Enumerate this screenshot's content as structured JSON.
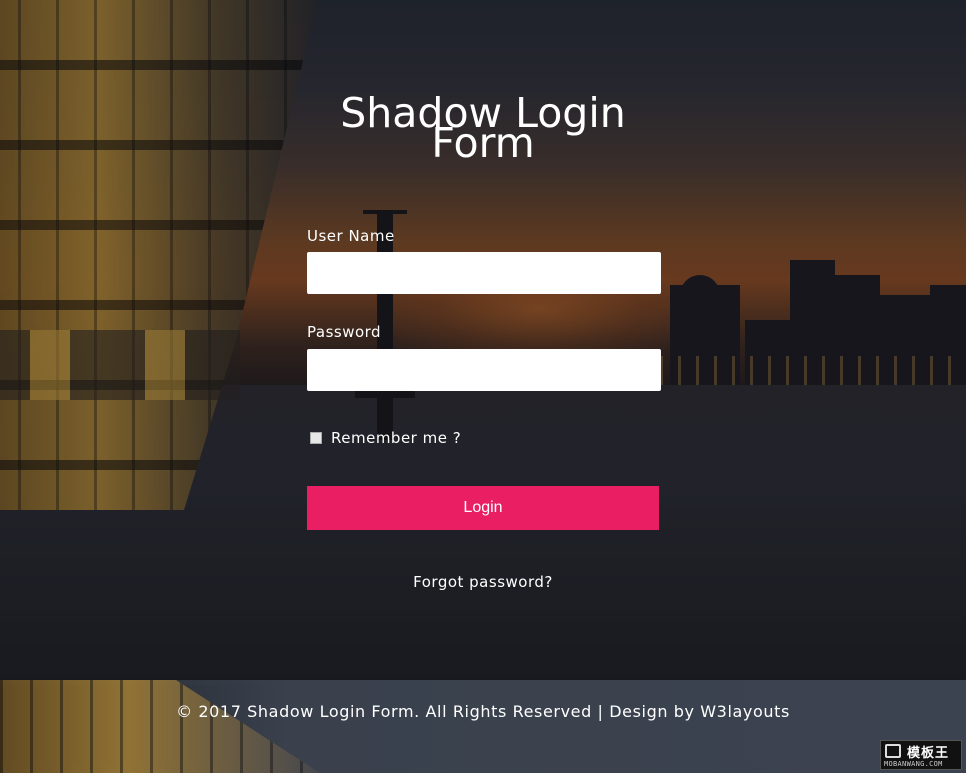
{
  "form": {
    "title": "Shadow Login Form",
    "username_label": "User Name",
    "username_value": "",
    "password_label": "Password",
    "password_value": "",
    "remember_label": "Remember me ?",
    "remember_checked": false,
    "login_label": "Login",
    "forgot_label": "Forgot password?"
  },
  "footer": {
    "text": "© 2017 Shadow Login Form. All Rights Reserved | Design by W3layouts"
  },
  "watermark": {
    "name": "模板王",
    "url": "MOBANWANG.COM"
  },
  "colors": {
    "accent": "#e91e63",
    "field_bg": "#ffffff",
    "text": "#ffffff"
  }
}
